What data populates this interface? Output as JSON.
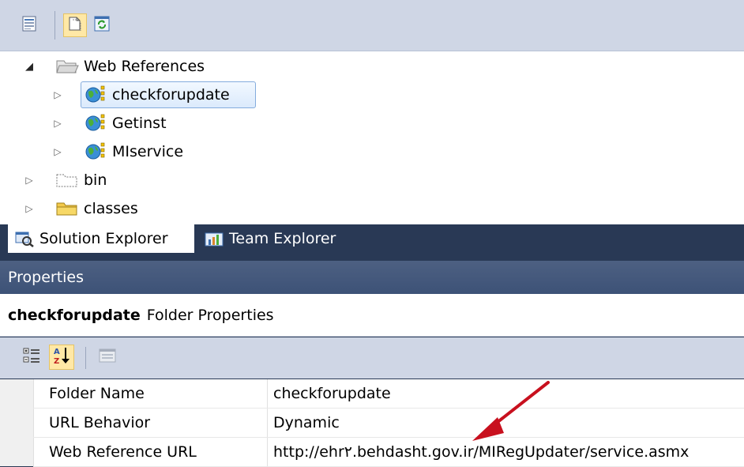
{
  "solution_explorer": {
    "tree": [
      {
        "label": "Web References",
        "icon": "folder-open-icon",
        "expanded": true,
        "selected": false
      },
      {
        "label": "checkforupdate",
        "icon": "web-reference-icon",
        "expanded": false,
        "selected": true
      },
      {
        "label": "Getinst",
        "icon": "web-reference-icon",
        "expanded": false,
        "selected": false
      },
      {
        "label": "MIservice",
        "icon": "web-reference-icon",
        "expanded": false,
        "selected": false
      },
      {
        "label": "bin",
        "icon": "folder-dashed-icon",
        "expanded": false,
        "selected": false
      },
      {
        "label": "classes",
        "icon": "folder-icon",
        "expanded": false,
        "selected": false
      }
    ]
  },
  "tabs": [
    {
      "label": "Solution Explorer",
      "icon": "solution-explorer-icon",
      "active": true
    },
    {
      "label": "Team Explorer",
      "icon": "team-explorer-icon",
      "active": false
    }
  ],
  "properties": {
    "title": "Properties",
    "object_name": "checkforupdate",
    "object_type": "Folder Properties",
    "rows": [
      {
        "name": "Folder Name",
        "value": "checkforupdate"
      },
      {
        "name": "URL Behavior",
        "value": "Dynamic"
      },
      {
        "name": "Web Reference URL",
        "value": "http://ehr۲.behdasht.gov.ir/MIRegUpdater/service.asmx"
      }
    ]
  },
  "colors": {
    "accent_dark": "#293955",
    "selection": "#dbeafc",
    "toolbar": "#cfd6e5",
    "arrow": "#c8101e"
  }
}
